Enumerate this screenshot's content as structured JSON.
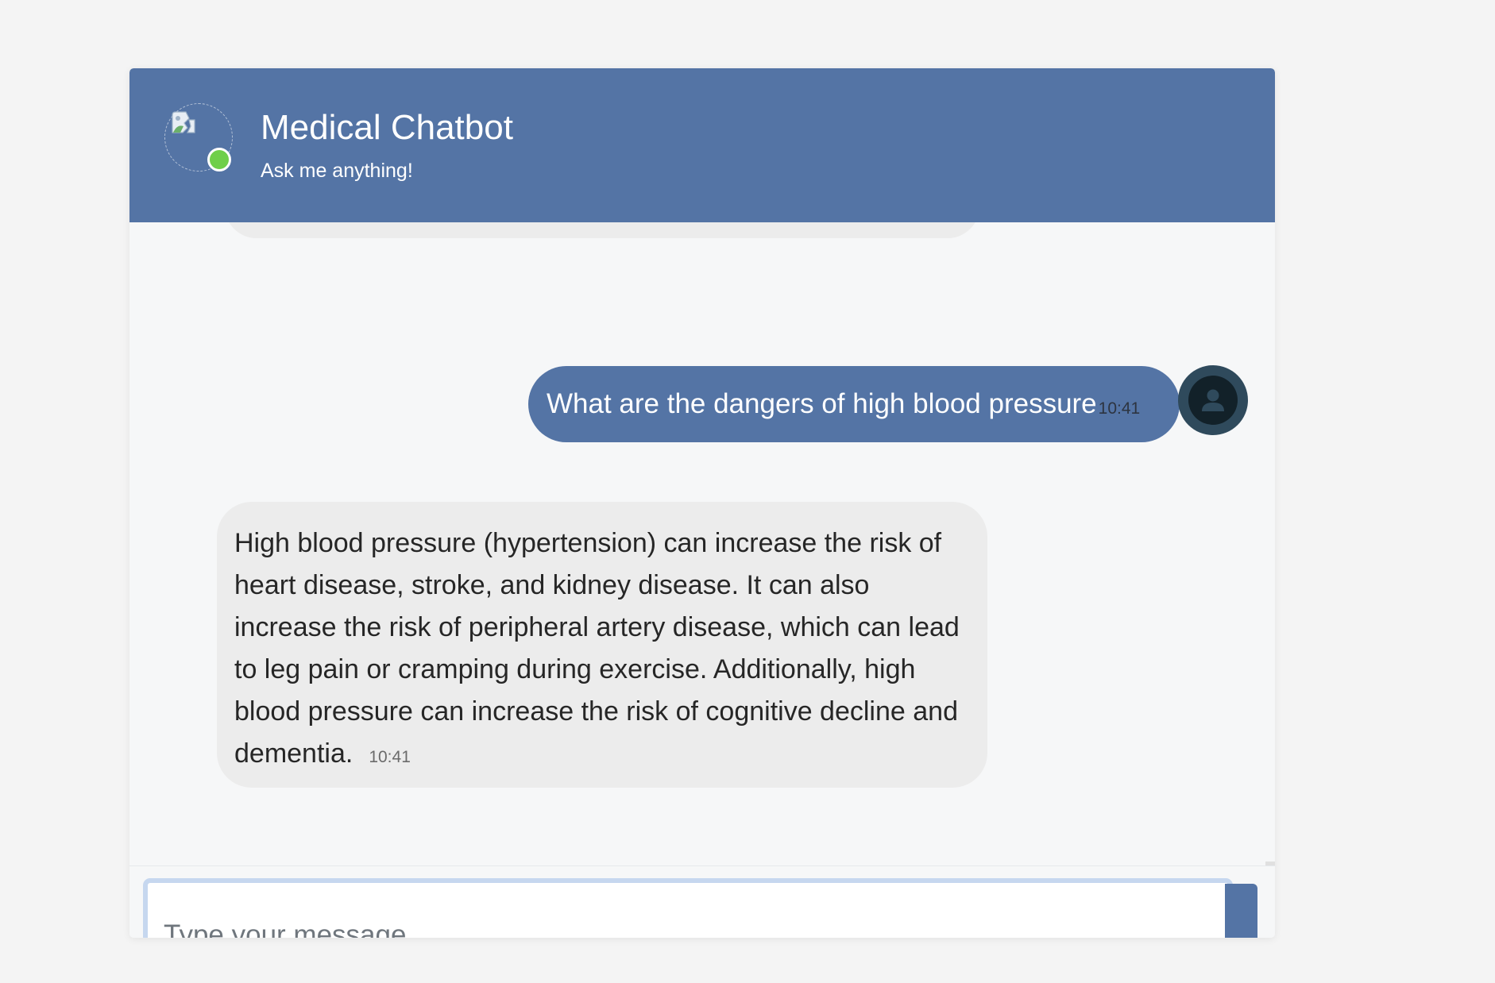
{
  "header": {
    "title": "Medical Chatbot",
    "subtitle": "Ask me anything!",
    "status": "online"
  },
  "messages": [
    {
      "sender": "user",
      "text": "What are the dangers of high blood pressure",
      "time": "10:41"
    },
    {
      "sender": "bot",
      "text": "High blood pressure (hypertension) can increase the risk of heart disease, stroke, and kidney disease. It can also increase the risk of peripheral artery disease, which can lead to leg pain or cramping during exercise. Additionally, high blood pressure can increase the risk of cognitive decline and dementia.",
      "time": "10:41"
    }
  ],
  "input": {
    "placeholder": "Type your message...",
    "value": ""
  },
  "colors": {
    "accent": "#5474a5",
    "online": "#6fcf4a",
    "bot_bubble": "#ececec",
    "user_avatar": "#2f4a5c"
  },
  "icons": {
    "bot_avatar": "broken-image-icon",
    "user_avatar": "user-icon"
  }
}
